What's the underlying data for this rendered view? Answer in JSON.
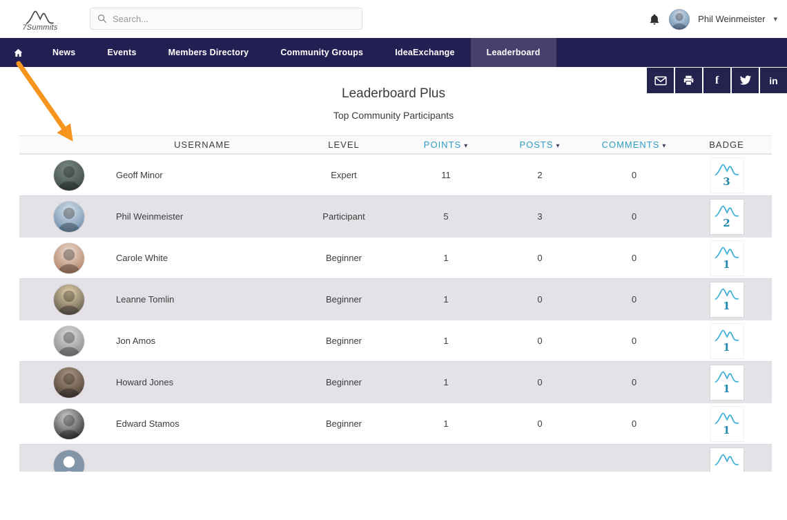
{
  "header": {
    "logo_text": "7Summits",
    "search": {
      "placeholder": "Search..."
    },
    "user": {
      "name": "Phil Weinmeister"
    }
  },
  "icons": {
    "chevron_down": "▾",
    "sort_arrow": "▾",
    "facebook_glyph": "f",
    "linkedin_glyph": "in"
  },
  "nav": {
    "items": [
      {
        "label": "News",
        "active": false
      },
      {
        "label": "Events",
        "active": false
      },
      {
        "label": "Members Directory",
        "active": false
      },
      {
        "label": "Community Groups",
        "active": false
      },
      {
        "label": "IdeaExchange",
        "active": false
      },
      {
        "label": "Leaderboard",
        "active": true
      }
    ]
  },
  "share": {
    "buttons": [
      "email",
      "print",
      "facebook",
      "twitter",
      "linkedin"
    ]
  },
  "page": {
    "title": "Leaderboard Plus",
    "subtitle": "Top Community Participants"
  },
  "table": {
    "columns": [
      {
        "label": "USERNAME",
        "sortable": false
      },
      {
        "label": "LEVEL",
        "sortable": false
      },
      {
        "label": "POINTS",
        "sortable": true
      },
      {
        "label": "POSTS",
        "sortable": true
      },
      {
        "label": "COMMENTS",
        "sortable": true
      },
      {
        "label": "BADGE",
        "sortable": false
      }
    ],
    "rows": [
      {
        "username": "Geoff Minor",
        "level": "Expert",
        "points": "11",
        "posts": "2",
        "comments": "0",
        "badge": "3"
      },
      {
        "username": "Phil Weinmeister",
        "level": "Participant",
        "points": "5",
        "posts": "3",
        "comments": "0",
        "badge": "2"
      },
      {
        "username": "Carole White",
        "level": "Beginner",
        "points": "1",
        "posts": "0",
        "comments": "0",
        "badge": "1"
      },
      {
        "username": "Leanne Tomlin",
        "level": "Beginner",
        "points": "1",
        "posts": "0",
        "comments": "0",
        "badge": "1"
      },
      {
        "username": "Jon Amos",
        "level": "Beginner",
        "points": "1",
        "posts": "0",
        "comments": "0",
        "badge": "1"
      },
      {
        "username": "Howard Jones",
        "level": "Beginner",
        "points": "1",
        "posts": "0",
        "comments": "0",
        "badge": "1"
      },
      {
        "username": "Edward Stamos",
        "level": "Beginner",
        "points": "1",
        "posts": "0",
        "comments": "0",
        "badge": "1"
      },
      {
        "username": "",
        "level": "",
        "points": "",
        "posts": "",
        "comments": "",
        "badge": ""
      }
    ]
  },
  "colors": {
    "nav_background": "#231f52",
    "nav_active": "#443f6b",
    "accent_teal": "#2d9dc4",
    "badge_blue": "#45b1d8",
    "row_alt": "#e4e2e7",
    "annotation_orange": "#f7941e"
  }
}
